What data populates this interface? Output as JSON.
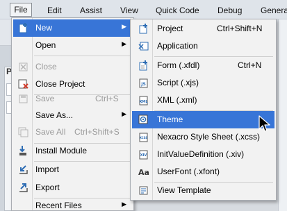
{
  "menubar": {
    "items": [
      "File",
      "Edit",
      "Assist",
      "View",
      "Quick Code",
      "Debug",
      "Generat"
    ]
  },
  "bg_panel_label": "P",
  "file_menu": {
    "items": [
      {
        "label": "New",
        "shortcut": "",
        "submenu": true,
        "enabled": true,
        "highlighted": true,
        "icon": "new-icon"
      },
      {
        "label": "Open",
        "shortcut": "",
        "submenu": true,
        "enabled": true,
        "highlighted": false,
        "icon": "none"
      },
      {
        "label": "Close",
        "shortcut": "",
        "submenu": false,
        "enabled": false,
        "highlighted": false,
        "icon": "close-x-icon"
      },
      {
        "label": "Close Project",
        "shortcut": "",
        "submenu": false,
        "enabled": true,
        "highlighted": false,
        "icon": "close-project-icon"
      },
      {
        "label": "Save",
        "shortcut": "Ctrl+S",
        "submenu": false,
        "enabled": false,
        "highlighted": false,
        "icon": "save-icon"
      },
      {
        "label": "Save As...",
        "shortcut": "",
        "submenu": true,
        "enabled": true,
        "highlighted": false,
        "icon": "none"
      },
      {
        "label": "Save All",
        "shortcut": "Ctrl+Shift+S",
        "submenu": false,
        "enabled": false,
        "highlighted": false,
        "icon": "save-all-icon"
      },
      {
        "label": "Install Module",
        "shortcut": "",
        "submenu": false,
        "enabled": true,
        "highlighted": false,
        "icon": "install-module-icon"
      },
      {
        "label": "Import",
        "shortcut": "",
        "submenu": false,
        "enabled": true,
        "highlighted": false,
        "icon": "import-icon"
      },
      {
        "label": "Export",
        "shortcut": "",
        "submenu": false,
        "enabled": true,
        "highlighted": false,
        "icon": "export-icon"
      },
      {
        "label": "Recent Files",
        "shortcut": "",
        "submenu": true,
        "enabled": true,
        "highlighted": false,
        "icon": "none"
      }
    ]
  },
  "new_menu": {
    "items": [
      {
        "label": "Project",
        "shortcut": "Ctrl+Shift+N",
        "highlighted": false,
        "icon": "project-icon"
      },
      {
        "label": "Application",
        "shortcut": "",
        "highlighted": false,
        "icon": "application-icon"
      },
      {
        "label": "Form (.xfdl)",
        "shortcut": "Ctrl+N",
        "highlighted": false,
        "icon": "form-icon"
      },
      {
        "label": "Script (.xjs)",
        "shortcut": "",
        "highlighted": false,
        "icon": "script-icon"
      },
      {
        "label": "XML (.xml)",
        "shortcut": "",
        "highlighted": false,
        "icon": "xml-icon"
      },
      {
        "label": "Theme",
        "shortcut": "",
        "highlighted": true,
        "icon": "theme-icon"
      },
      {
        "label": "Nexacro Style Sheet (.xcss)",
        "shortcut": "",
        "highlighted": false,
        "icon": "style-sheet-icon"
      },
      {
        "label": "InitValueDefinition (.xiv)",
        "shortcut": "",
        "highlighted": false,
        "icon": "init-value-icon"
      },
      {
        "label": "UserFont (.xfont)",
        "shortcut": "",
        "highlighted": false,
        "icon": "user-font-icon"
      },
      {
        "label": "View Template",
        "shortcut": "",
        "highlighted": false,
        "icon": "view-template-icon"
      }
    ]
  },
  "icon_glyphs": {
    "script": "JS",
    "xml": "XML",
    "style_sheet": "XCSS",
    "init_value": "XIV",
    "user_font": "Aa"
  },
  "colors": {
    "highlight": "#3875d7",
    "icon_blue": "#2e6db4",
    "disabled_text": "#9a9a9a"
  }
}
